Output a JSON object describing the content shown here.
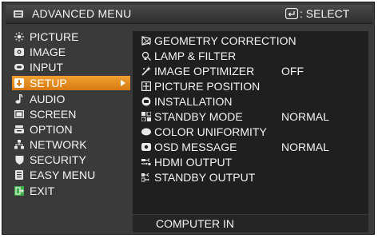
{
  "header": {
    "title": "ADVANCED MENU",
    "select_hint": ": SELECT",
    "menu_icon": "menu-icon",
    "select_icon": "enter-key-icon"
  },
  "left_menu": {
    "items": [
      {
        "label": "PICTURE",
        "icon": "sun-icon"
      },
      {
        "label": "IMAGE",
        "icon": "image-icon"
      },
      {
        "label": "INPUT",
        "icon": "input-icon"
      },
      {
        "label": "SETUP",
        "icon": "setup-icon",
        "selected": true
      },
      {
        "label": "AUDIO",
        "icon": "music-note-icon"
      },
      {
        "label": "SCREEN",
        "icon": "screen-icon"
      },
      {
        "label": "OPTION",
        "icon": "option-icon"
      },
      {
        "label": "NETWORK",
        "icon": "network-icon"
      },
      {
        "label": "SECURITY",
        "icon": "shield-icon"
      },
      {
        "label": "EASY MENU",
        "icon": "easy-menu-icon"
      },
      {
        "label": "EXIT",
        "icon": "exit-icon"
      }
    ],
    "selected_color": "#e8901f"
  },
  "right_panel": {
    "items": [
      {
        "label": "GEOMETRY CORRECTION",
        "value": "",
        "icon": "geometry-icon"
      },
      {
        "label": "LAMP & FILTER",
        "value": "",
        "icon": "lamp-icon"
      },
      {
        "label": "IMAGE OPTIMIZER",
        "value": "OFF",
        "icon": "optimizer-icon"
      },
      {
        "label": "PICTURE POSITION",
        "value": "",
        "icon": "position-icon"
      },
      {
        "label": "INSTALLATION",
        "value": "",
        "icon": "installation-icon"
      },
      {
        "label": "STANDBY MODE",
        "value": "NORMAL",
        "icon": "standby-icon"
      },
      {
        "label": "COLOR UNIFORMITY",
        "value": "",
        "icon": "color-uniformity-icon"
      },
      {
        "label": "OSD MESSAGE",
        "value": "NORMAL",
        "icon": "osd-icon"
      },
      {
        "label": "HDMI OUTPUT",
        "value": "",
        "icon": "hdmi-icon"
      },
      {
        "label": "STANDBY OUTPUT",
        "value": "",
        "icon": "standby-output-icon"
      }
    ]
  },
  "footer": {
    "label": "COMPUTER IN"
  }
}
